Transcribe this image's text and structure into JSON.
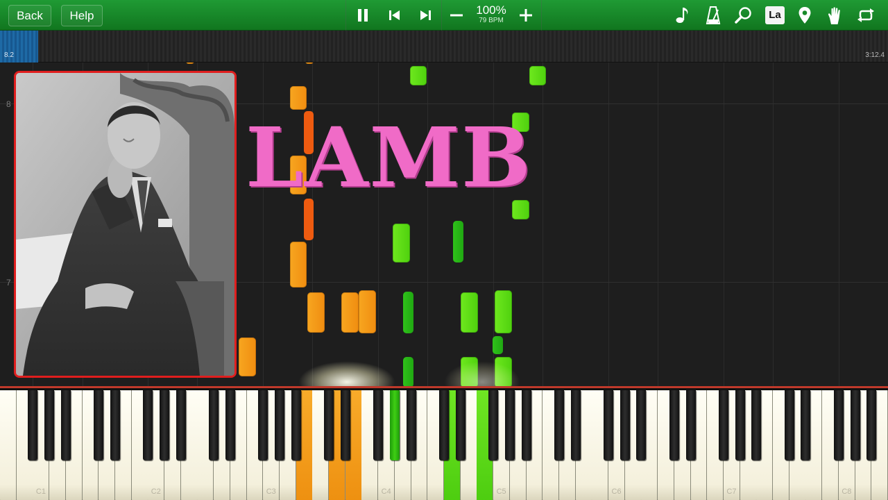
{
  "toolbar": {
    "back_label": "Back",
    "help_label": "Help",
    "tempo_percent": "100%",
    "tempo_bpm": "79 BPM",
    "label_mode_text": "La",
    "icons": [
      "pause-icon",
      "rewind-icon",
      "forward-icon",
      "minus-icon",
      "plus-icon",
      "note-icon",
      "metronome-icon",
      "magnifier-icon",
      "label-icon",
      "marker-icon",
      "hand-icon",
      "loop-icon"
    ]
  },
  "timeline": {
    "position": "8.2",
    "duration": "3:12.4",
    "progress_fraction": 0.043
  },
  "roll": {
    "measure_numbers": [
      "8",
      "7"
    ]
  },
  "overlay": {
    "title": "LAMB"
  },
  "keyboard": {
    "octave_labels": [
      "C1",
      "C2",
      "C3",
      "C4",
      "C5",
      "C6",
      "C7",
      "C8"
    ]
  },
  "colors": {
    "toolbar_green": "#178a28",
    "left_hand": "#f59a16",
    "right_hand": "#5ad916",
    "photo_frame": "#e01e1e",
    "title_pink": "#f06bc7"
  }
}
